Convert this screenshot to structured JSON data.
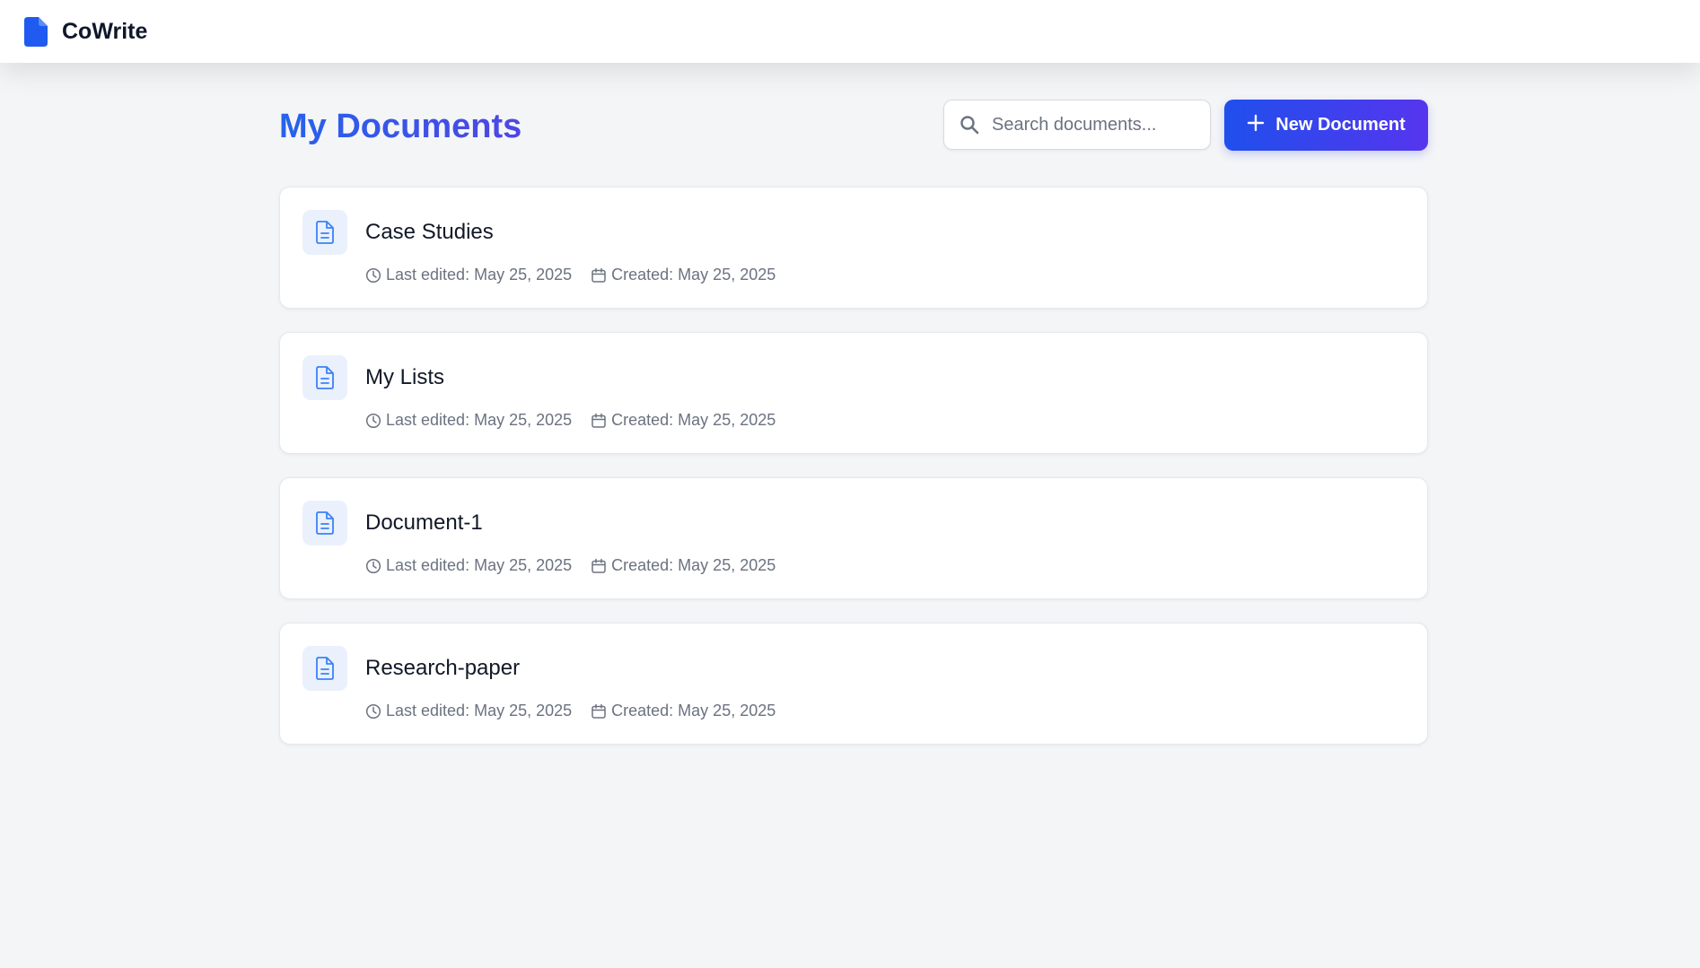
{
  "app": {
    "name": "CoWrite",
    "logo_icon": "document-icon",
    "brand_color": "#2563eb"
  },
  "page": {
    "title": "My Documents"
  },
  "search": {
    "placeholder": "Search documents...",
    "value": "",
    "icon": "search-icon"
  },
  "new_document_button": {
    "label": "New Document",
    "icon": "plus-icon"
  },
  "documents": [
    {
      "title": "Case Studies",
      "last_edited": "Last edited: May 25, 2025",
      "created": "Created: May 25, 2025"
    },
    {
      "title": "My Lists",
      "last_edited": "Last edited: May 25, 2025",
      "created": "Created: May 25, 2025"
    },
    {
      "title": "Document-1",
      "last_edited": "Last edited: May 25, 2025",
      "created": "Created: May 25, 2025"
    },
    {
      "title": "Research-paper",
      "last_edited": "Last edited: May 25, 2025",
      "created": "Created: May 25, 2025"
    }
  ]
}
